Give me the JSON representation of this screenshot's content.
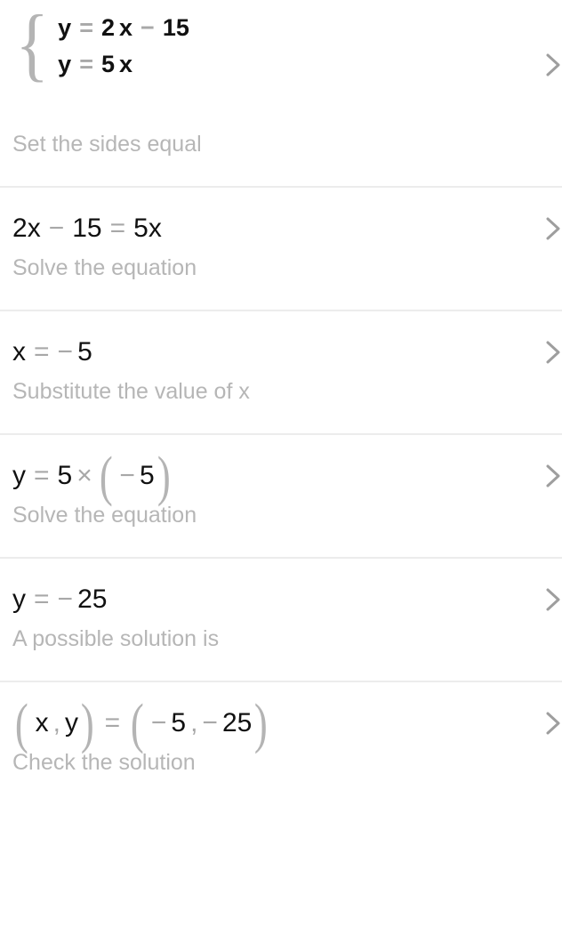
{
  "app": {
    "background_color": "#ffffff",
    "expression_color": "#111111",
    "operator_color": "#a8a8a8",
    "caption_color": "#b6b6b6",
    "divider_color": "#ececec",
    "chevron_icon": "chevron-right-icon"
  },
  "steps": [
    {
      "type": "system",
      "equations": [
        {
          "lhs": "y",
          "eq": "=",
          "coef": "2",
          "var": "x",
          "op": "−",
          "const": "15"
        },
        {
          "lhs": "y",
          "eq": "=",
          "coef": "5",
          "var": "x"
        }
      ],
      "expression_text": "y = 2x − 15 ; y = 5x",
      "caption": "Set the sides equal",
      "chevron": "›"
    },
    {
      "type": "equation",
      "tokens": [
        "2",
        "x",
        "−",
        "15",
        "=",
        "5",
        "x"
      ],
      "expression_text": "2x − 15 = 5x",
      "caption": "Solve the equation",
      "chevron": "›"
    },
    {
      "type": "equation",
      "tokens": [
        "x",
        "=",
        "−",
        "5"
      ],
      "expression_text": "x = − 5",
      "caption": "Substitute the value of x",
      "chevron": "›"
    },
    {
      "type": "equation",
      "tokens": [
        "y",
        "=",
        "5",
        "×",
        "(",
        "−",
        "5",
        ")"
      ],
      "expression_text": "y = 5 × ( − 5 )",
      "caption": "Solve the equation",
      "chevron": "›"
    },
    {
      "type": "equation",
      "tokens": [
        "y",
        "=",
        "−",
        "25"
      ],
      "expression_text": "y = − 25",
      "caption": "A possible solution is",
      "chevron": "›"
    },
    {
      "type": "solution",
      "tokens": [
        "(",
        "x",
        ",",
        "y",
        ")",
        "=",
        "(",
        "−",
        "5",
        ",",
        "−",
        "25",
        ")"
      ],
      "expression_text": "( x , y ) = ( − 5 , − 25 )",
      "caption": "Check the solution",
      "chevron": "›"
    }
  ],
  "math": {
    "y": "y",
    "x": "x",
    "equals": "=",
    "minus": "−",
    "times": "×",
    "comma": ",",
    "lparen": "(",
    "rparen": ")",
    "brace_left": "{",
    "two": "2",
    "five": "5",
    "fifteen": "15",
    "twentyfive": "25"
  }
}
